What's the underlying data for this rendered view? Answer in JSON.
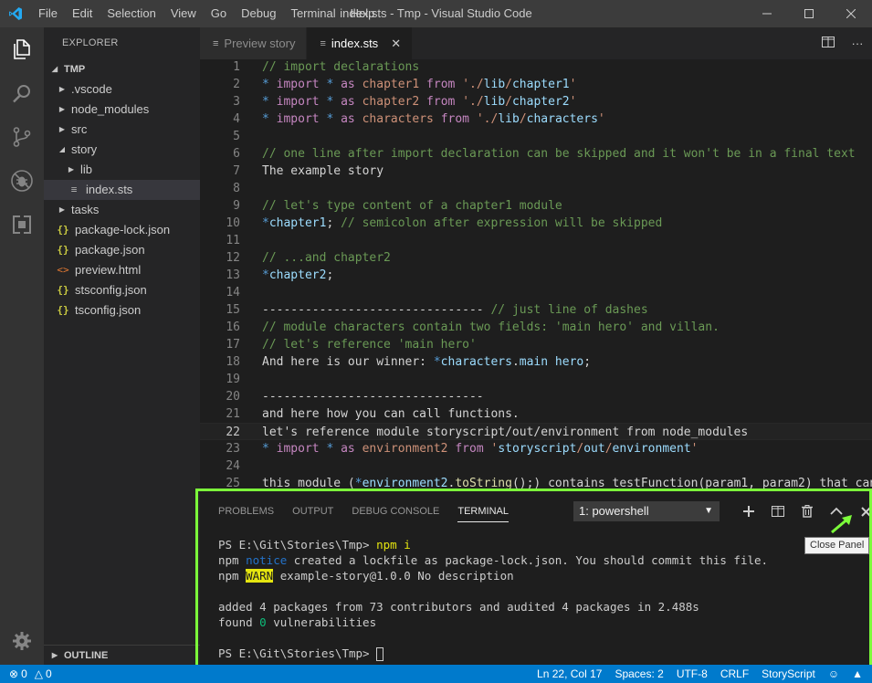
{
  "window": {
    "title": "index.sts - Tmp - Visual Studio Code",
    "menu": [
      "File",
      "Edit",
      "Selection",
      "View",
      "Go",
      "Debug",
      "Terminal",
      "Help"
    ]
  },
  "activity_bar": {
    "items": [
      "files-icon",
      "search-icon",
      "source-control-icon",
      "debug-icon",
      "extensions-icon"
    ],
    "bottom": "gear-icon"
  },
  "sidebar": {
    "title": "EXPLORER",
    "root": "TMP",
    "tree": [
      {
        "label": ".vscode",
        "type": "folder",
        "expanded": false,
        "depth": 1
      },
      {
        "label": "node_modules",
        "type": "folder",
        "expanded": false,
        "depth": 1
      },
      {
        "label": "src",
        "type": "folder",
        "expanded": false,
        "depth": 1
      },
      {
        "label": "story",
        "type": "folder",
        "expanded": true,
        "depth": 1
      },
      {
        "label": "lib",
        "type": "folder",
        "expanded": false,
        "depth": 2
      },
      {
        "label": "index.sts",
        "type": "file-text",
        "depth": 2,
        "selected": true
      },
      {
        "label": "tasks",
        "type": "folder",
        "expanded": false,
        "depth": 1
      },
      {
        "label": "package-lock.json",
        "type": "json",
        "depth": 1
      },
      {
        "label": "package.json",
        "type": "json",
        "depth": 1
      },
      {
        "label": "preview.html",
        "type": "html",
        "depth": 1
      },
      {
        "label": "stsconfig.json",
        "type": "json",
        "depth": 1
      },
      {
        "label": "tsconfig.json",
        "type": "json",
        "depth": 1
      }
    ],
    "outline": "OUTLINE"
  },
  "tabs": [
    {
      "label": "Preview story",
      "active": false
    },
    {
      "label": "index.sts",
      "active": true
    }
  ],
  "editor": {
    "current_line": 22,
    "lines": [
      {
        "n": "1",
        "tokens": [
          [
            "c-comment",
            "// import declarations"
          ]
        ]
      },
      {
        "n": "2",
        "tokens": [
          [
            "c-kw",
            "* "
          ],
          [
            "c-mag",
            "import"
          ],
          [
            "c-plain",
            " "
          ],
          [
            "c-kw",
            "*"
          ],
          [
            "c-plain",
            " "
          ],
          [
            "c-mag",
            "as"
          ],
          [
            "c-plain",
            " "
          ],
          [
            "c-str",
            "chapter1"
          ],
          [
            "c-plain",
            " "
          ],
          [
            "c-mag",
            "from"
          ],
          [
            "c-plain",
            " "
          ],
          [
            "c-str",
            "'./"
          ],
          [
            "c-id",
            "lib"
          ],
          [
            "c-str",
            "/"
          ],
          [
            "c-id",
            "chapter1"
          ],
          [
            "c-str",
            "'"
          ]
        ]
      },
      {
        "n": "3",
        "tokens": [
          [
            "c-kw",
            "* "
          ],
          [
            "c-mag",
            "import"
          ],
          [
            "c-plain",
            " "
          ],
          [
            "c-kw",
            "*"
          ],
          [
            "c-plain",
            " "
          ],
          [
            "c-mag",
            "as"
          ],
          [
            "c-plain",
            " "
          ],
          [
            "c-str",
            "chapter2"
          ],
          [
            "c-plain",
            " "
          ],
          [
            "c-mag",
            "from"
          ],
          [
            "c-plain",
            " "
          ],
          [
            "c-str",
            "'./"
          ],
          [
            "c-id",
            "lib"
          ],
          [
            "c-str",
            "/"
          ],
          [
            "c-id",
            "chapter2"
          ],
          [
            "c-str",
            "'"
          ]
        ]
      },
      {
        "n": "4",
        "tokens": [
          [
            "c-kw",
            "* "
          ],
          [
            "c-mag",
            "import"
          ],
          [
            "c-plain",
            " "
          ],
          [
            "c-kw",
            "*"
          ],
          [
            "c-plain",
            " "
          ],
          [
            "c-mag",
            "as"
          ],
          [
            "c-plain",
            " "
          ],
          [
            "c-str",
            "characters"
          ],
          [
            "c-plain",
            " "
          ],
          [
            "c-mag",
            "from"
          ],
          [
            "c-plain",
            " "
          ],
          [
            "c-str",
            "'./"
          ],
          [
            "c-id",
            "lib"
          ],
          [
            "c-str",
            "/"
          ],
          [
            "c-id",
            "characters"
          ],
          [
            "c-str",
            "'"
          ]
        ]
      },
      {
        "n": "5",
        "tokens": []
      },
      {
        "n": "6",
        "tokens": [
          [
            "c-comment",
            "// one line after import declaration can be skipped and it won't be in a final text"
          ]
        ]
      },
      {
        "n": "7",
        "tokens": [
          [
            "c-plain",
            "The example story"
          ]
        ]
      },
      {
        "n": "8",
        "tokens": []
      },
      {
        "n": "9",
        "tokens": [
          [
            "c-comment",
            "// let's type content of a chapter1 module"
          ]
        ]
      },
      {
        "n": "10",
        "tokens": [
          [
            "c-kw",
            "*"
          ],
          [
            "c-id",
            "chapter1"
          ],
          [
            "c-plain",
            ";"
          ],
          [
            "c-comment",
            " // semicolon after expression will be skipped"
          ]
        ]
      },
      {
        "n": "11",
        "tokens": []
      },
      {
        "n": "12",
        "tokens": [
          [
            "c-comment",
            "// ...and chapter2"
          ]
        ]
      },
      {
        "n": "13",
        "tokens": [
          [
            "c-kw",
            "*"
          ],
          [
            "c-id",
            "chapter2"
          ],
          [
            "c-plain",
            ";"
          ]
        ]
      },
      {
        "n": "14",
        "tokens": []
      },
      {
        "n": "15",
        "tokens": [
          [
            "c-plain",
            "-------------------------------"
          ],
          [
            "c-comment",
            " // just line of dashes"
          ]
        ]
      },
      {
        "n": "16",
        "tokens": [
          [
            "c-comment",
            "// module characters contain two fields: 'main hero' and villan."
          ]
        ]
      },
      {
        "n": "17",
        "tokens": [
          [
            "c-comment",
            "// let's reference 'main hero'"
          ]
        ]
      },
      {
        "n": "18",
        "tokens": [
          [
            "c-plain",
            "And here is our winner: "
          ],
          [
            "c-kw",
            "*"
          ],
          [
            "c-id",
            "characters"
          ],
          [
            "c-plain",
            "."
          ],
          [
            "c-id",
            "main hero"
          ],
          [
            "c-plain",
            ";"
          ]
        ]
      },
      {
        "n": "19",
        "tokens": []
      },
      {
        "n": "20",
        "tokens": [
          [
            "c-plain",
            "-------------------------------"
          ]
        ]
      },
      {
        "n": "21",
        "tokens": [
          [
            "c-plain",
            "and here how you can call functions."
          ]
        ]
      },
      {
        "n": "22",
        "tokens": [
          [
            "c-plain",
            "let's reference module storyscript/out/environment from node_modules"
          ]
        ]
      },
      {
        "n": "23",
        "tokens": [
          [
            "c-kw",
            "* "
          ],
          [
            "c-mag",
            "import"
          ],
          [
            "c-plain",
            " "
          ],
          [
            "c-kw",
            "*"
          ],
          [
            "c-plain",
            " "
          ],
          [
            "c-mag",
            "as"
          ],
          [
            "c-plain",
            " "
          ],
          [
            "c-str",
            "environment2"
          ],
          [
            "c-plain",
            " "
          ],
          [
            "c-mag",
            "from"
          ],
          [
            "c-plain",
            " "
          ],
          [
            "c-str",
            "'"
          ],
          [
            "c-id",
            "storyscript"
          ],
          [
            "c-str",
            "/"
          ],
          [
            "c-id",
            "out"
          ],
          [
            "c-str",
            "/"
          ],
          [
            "c-id",
            "environment"
          ],
          [
            "c-str",
            "'"
          ]
        ]
      },
      {
        "n": "24",
        "tokens": []
      },
      {
        "n": "25",
        "tokens": [
          [
            "c-plain",
            "this module ("
          ],
          [
            "c-kw",
            "*"
          ],
          [
            "c-id",
            "environment2"
          ],
          [
            "c-plain",
            "."
          ],
          [
            "c-fn",
            "toString"
          ],
          [
            "c-plain",
            "();) contains testFunction(param1, param2) that can"
          ]
        ]
      }
    ]
  },
  "panel": {
    "tabs": [
      "PROBLEMS",
      "OUTPUT",
      "DEBUG CONSOLE",
      "TERMINAL"
    ],
    "active_tab": "TERMINAL",
    "terminal_select": "1: powershell",
    "actions": [
      "plus-icon",
      "split-icon",
      "trash-icon",
      "chevron-up-icon",
      "close-icon"
    ],
    "terminal_lines": [
      {
        "tokens": [
          [
            "",
            "PS E:\\Git\\Stories\\Tmp> "
          ],
          [
            "t-yellow",
            "npm i"
          ]
        ]
      },
      {
        "tokens": [
          [
            "",
            "npm "
          ],
          [
            "t-blue",
            "notice"
          ],
          [
            "",
            " created a lockfile as package-lock.json. You should commit this file."
          ]
        ]
      },
      {
        "tokens": [
          [
            "",
            "npm "
          ],
          [
            "t-warn",
            "WARN"
          ],
          [
            "",
            " example-story@1.0.0 No description"
          ]
        ]
      },
      {
        "tokens": []
      },
      {
        "tokens": [
          [
            "",
            "added 4 packages from 73 contributors and audited 4 packages in 2.488s"
          ]
        ]
      },
      {
        "tokens": [
          [
            "",
            "found "
          ],
          [
            "t-green",
            "0"
          ],
          [
            "",
            " vulnerabilities"
          ]
        ]
      },
      {
        "tokens": []
      },
      {
        "tokens": [
          [
            "",
            "PS E:\\Git\\Stories\\Tmp> "
          ]
        ],
        "cursor": true
      }
    ],
    "tooltip": "Close Panel"
  },
  "statusbar": {
    "errors": "0",
    "warnings": "0",
    "position": "Ln 22, Col 17",
    "spaces": "Spaces: 2",
    "encoding": "UTF-8",
    "eol": "CRLF",
    "language": "StoryScript"
  },
  "colors": {
    "accent": "#007acc",
    "highlight_box": "#7cfc3a"
  }
}
